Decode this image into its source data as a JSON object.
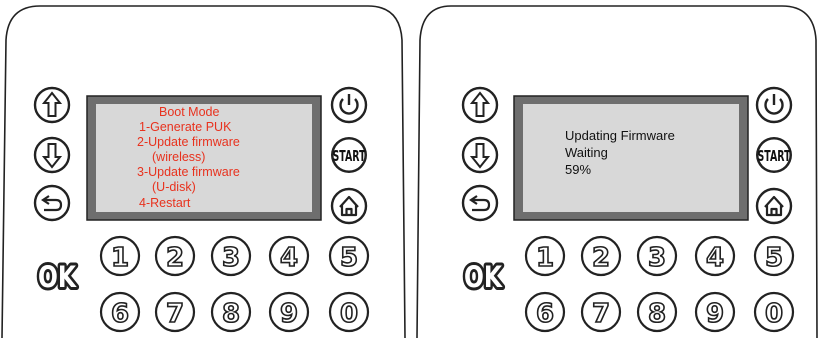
{
  "panels": [
    {
      "id": "boot-mode",
      "screen_text_color": "#e8321e",
      "screen_lines": [
        "Boot Mode",
        "1-Generate PUK",
        "2-Update firmware",
        "(wireless)",
        "3-Update firmware",
        "(U-disk)",
        "4-Restart"
      ]
    },
    {
      "id": "updating",
      "screen_text_color": "#111111",
      "screen_lines": [
        "Updating Firmware",
        "Waiting",
        "59%"
      ]
    }
  ],
  "keys": {
    "ok_label": "OK",
    "start_label": "START",
    "digits": [
      "1",
      "2",
      "3",
      "4",
      "5",
      "6",
      "7",
      "8",
      "9",
      "0"
    ],
    "left_icons": [
      "arrow-up-icon",
      "arrow-down-icon",
      "back-icon"
    ],
    "right_icons": [
      "power-icon",
      "start-icon",
      "home-icon"
    ]
  },
  "colors": {
    "screen_fill": "#d8d8d8",
    "bezel": "#6e6e6e",
    "outline": "#222222"
  }
}
